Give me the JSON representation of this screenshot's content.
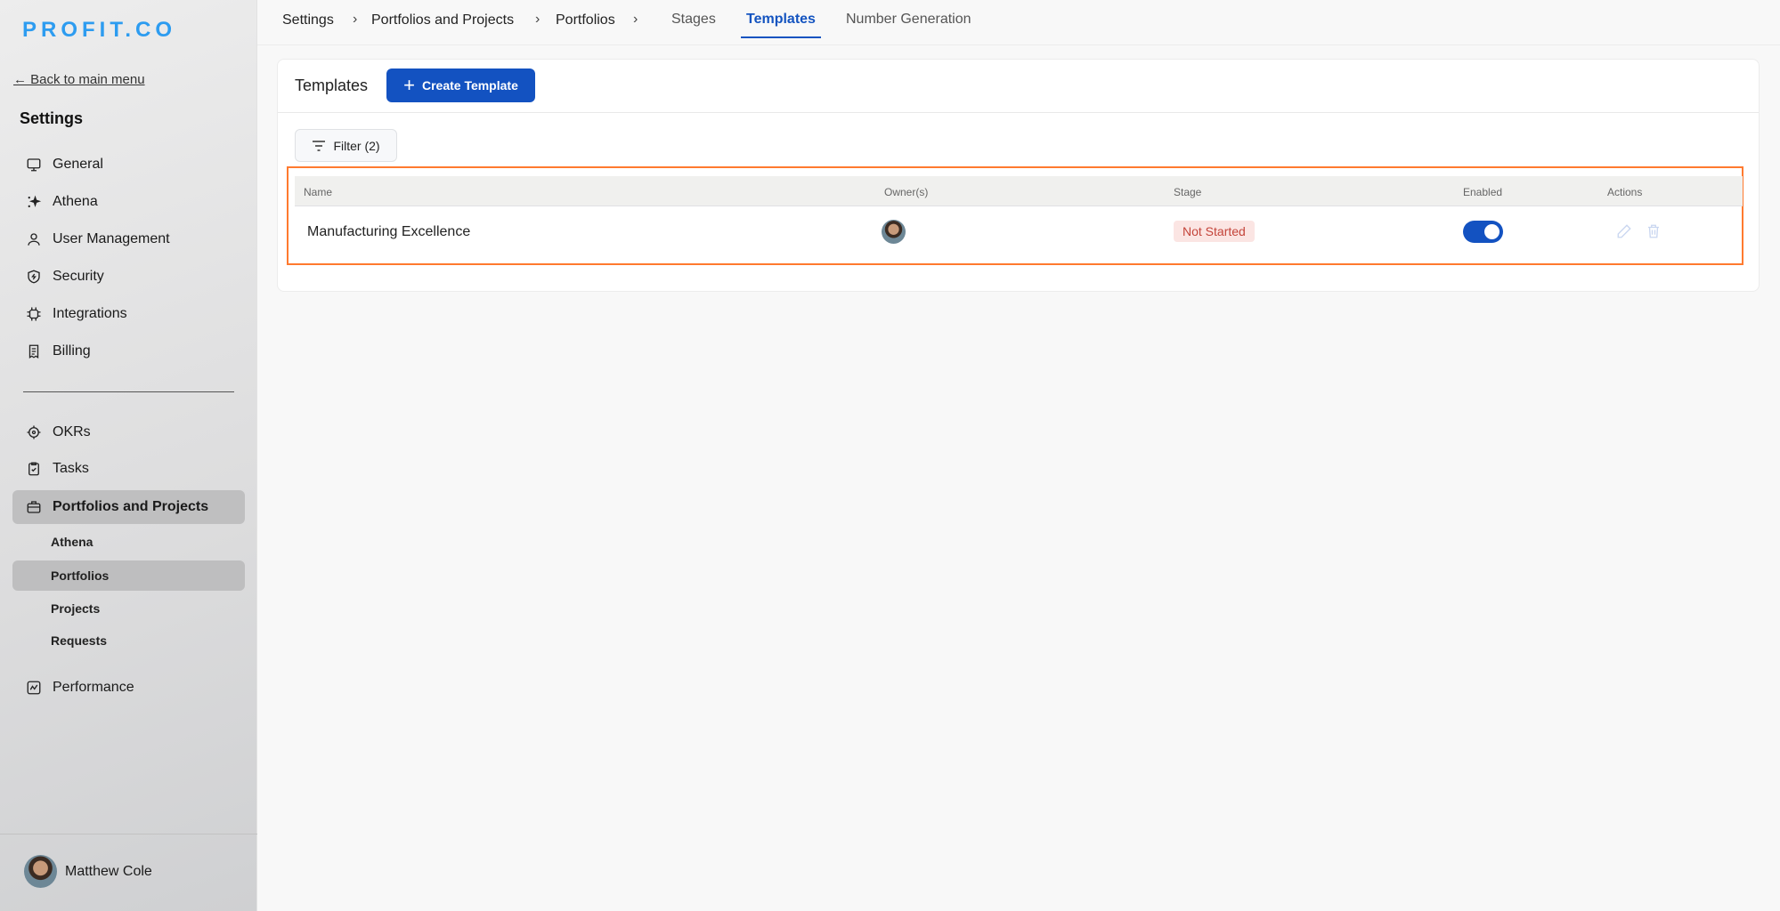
{
  "sidebar": {
    "logo": "PROFIT.CO",
    "back_label": "← Back to main menu",
    "title": "Settings",
    "items": [
      {
        "label": "General",
        "icon": "monitor-icon"
      },
      {
        "label": "Athena",
        "icon": "sparkles-icon"
      },
      {
        "label": "User Management",
        "icon": "user-icon"
      },
      {
        "label": "Security",
        "icon": "shield-icon"
      },
      {
        "label": "Integrations",
        "icon": "chip-icon"
      },
      {
        "label": "Billing",
        "icon": "receipt-icon"
      }
    ],
    "items2": [
      {
        "label": "OKRs",
        "icon": "target-icon"
      },
      {
        "label": "Tasks",
        "icon": "clipboard-check-icon"
      },
      {
        "label": "Portfolios and Projects",
        "icon": "briefcase-icon"
      }
    ],
    "subitems": [
      "Athena",
      "Portfolios",
      "Projects",
      "Requests"
    ],
    "performance": {
      "label": "Performance",
      "icon": "chart-line-icon"
    },
    "user_name": "Matthew Cole"
  },
  "breadcrumb": [
    "Settings",
    "Portfolios and Projects",
    "Portfolios"
  ],
  "tabs": [
    "Stages",
    "Templates",
    "Number Generation"
  ],
  "card": {
    "title": "Templates",
    "create_label": "Create Template",
    "filter_label": "Filter (2)"
  },
  "table": {
    "headers": [
      "Name",
      "Owner(s)",
      "Stage",
      "Enabled",
      "Actions"
    ],
    "rows": [
      {
        "name": "Manufacturing Excellence",
        "stage": "Not Started",
        "enabled": true
      }
    ]
  },
  "colors": {
    "accent": "#1352c1",
    "highlight": "#ff7a2f",
    "badge_bg": "#fbe5e3",
    "badge_text": "#c4443a"
  }
}
